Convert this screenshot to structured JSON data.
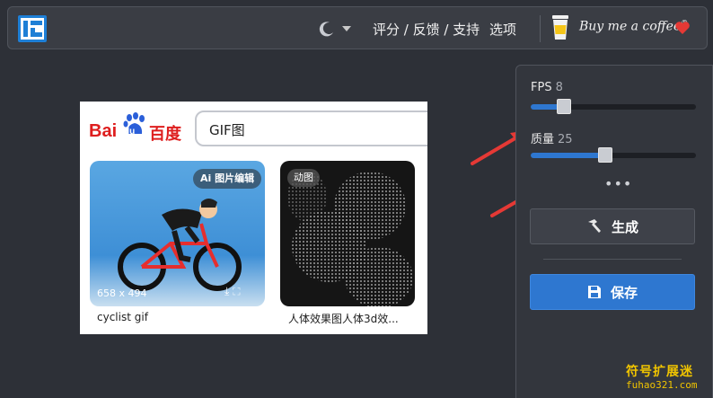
{
  "header": {
    "nav_feedback": "评分 / 反馈 / 支持",
    "nav_options": "选项",
    "buy_coffee": "Buy me a coffee",
    "buy_coffee_mark": "®"
  },
  "preview": {
    "search_brand_latin": "Bai",
    "search_brand_paw_text": "du",
    "search_brand_cn": "百度",
    "search_query": "GIF图",
    "results": [
      {
        "badge": "Ai 图片编辑",
        "dimensions": "658 x 494",
        "caption": "cyclist gif"
      },
      {
        "badge": "动图",
        "caption": "人体效果图人体3d效..."
      }
    ]
  },
  "panel": {
    "fps": {
      "label": "FPS",
      "value": "8",
      "fill_fraction": 0.2
    },
    "quality": {
      "label": "质量",
      "value": "25",
      "fill_fraction": 0.45
    },
    "more": "•••",
    "generate_label": "生成",
    "save_label": "保存"
  },
  "watermark": {
    "cn": "符号扩展迷",
    "en": "fuhao321.com"
  },
  "colors": {
    "accent": "#2e77d0",
    "arrow": "#e53935",
    "heart": "#e53935",
    "watermark": "#f0c400"
  }
}
